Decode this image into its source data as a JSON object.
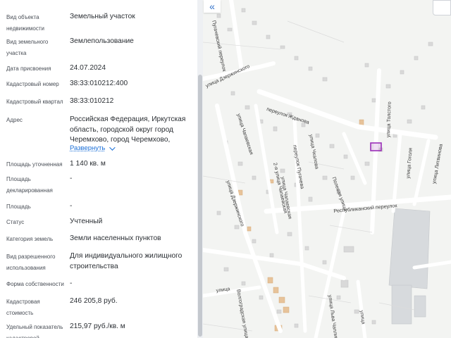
{
  "fields": [
    {
      "label": "Вид объекта недвижимости",
      "value": "Земельный участок"
    },
    {
      "label": "Вид земельного участка",
      "value": "Землепользование"
    },
    {
      "label": "Дата присвоения",
      "value": "24.07.2024"
    },
    {
      "label": "Кадастровый номер",
      "value": "38:33:010212:400"
    },
    {
      "label": "Кадастровый квартал",
      "value": "38:33:010212"
    },
    {
      "label": "Адрес",
      "value": "Российская Федерация, Иркутская область, городской округ город Черемхово, город Черемхово, улица"
    },
    {
      "label": "Площадь уточненная",
      "value": "1 140 кв. м"
    },
    {
      "label": "Площадь декларированная",
      "value": "-"
    },
    {
      "label": "Площадь",
      "value": "-"
    },
    {
      "label": "Статус",
      "value": "Учтенный"
    },
    {
      "label": "Категория земель",
      "value": "Земли населенных пунктов"
    },
    {
      "label": "Вид разрешенного использования",
      "value": "Для индивидуального жилищного строительства"
    },
    {
      "label": "Форма собственности",
      "value": "-"
    },
    {
      "label": "Кадастровая стоимость",
      "value": "246 205,8 руб."
    },
    {
      "label": "Удельный показатель кадастровой",
      "value": "215,97 руб./кв. м"
    }
  ],
  "expand_label": "Развернуть",
  "collapse_icon": "«",
  "map": {
    "streets": [
      "Пугачевский переулок",
      "улица Дзержинского",
      "переулок Жданова",
      "улица Чапаевская",
      "переулок Пугачева",
      "улица Чкалова",
      "2-я улица Чапаевская",
      "улица Дзержинского",
      "улица Чапаевская",
      "Полевая улица",
      "улица Толстого",
      "улица Гоголя",
      "улица Литвинова",
      "Республиканский переулок",
      "Волгоградская улица",
      "улица",
      "улица Льва Чаплина",
      "улица"
    ],
    "colors": {
      "parcel": "#9b2fb8",
      "road": "#ffffff",
      "building": "#e7c39a",
      "industrial": "#d7dadd"
    }
  }
}
